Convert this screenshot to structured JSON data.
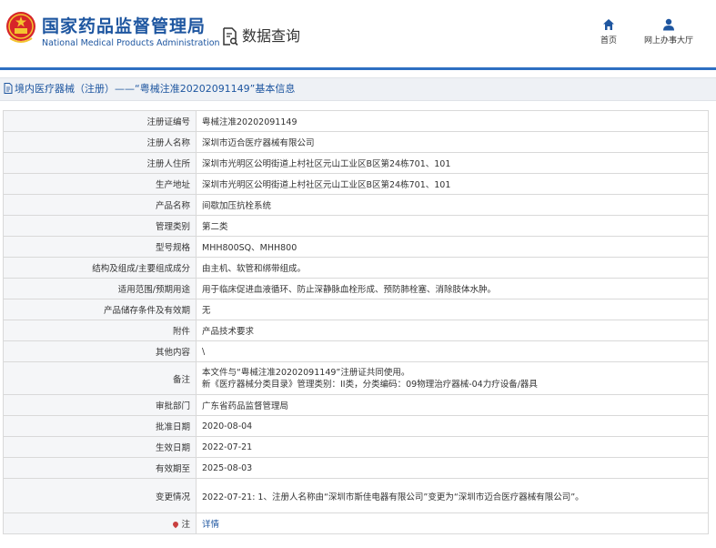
{
  "header": {
    "agency_cn": "国家药品监督管理局",
    "agency_en": "National Medical Products Administration",
    "query_label": "数据查询",
    "nav": [
      {
        "label": "首页",
        "icon": "home-icon"
      },
      {
        "label": "网上办事大厅",
        "icon": "user-icon"
      }
    ]
  },
  "title": "境内医疗器械（注册）——“粤械注准20202091149”基本信息",
  "colors": {
    "brand": "#1e56a0",
    "bar": "#2d6fc2",
    "label_bg": "#f5f6f8"
  },
  "rows": [
    {
      "label": "注册证编号",
      "value": "粤械注准20202091149"
    },
    {
      "label": "注册人名称",
      "value": "深圳市迈合医疗器械有限公司"
    },
    {
      "label": "注册人住所",
      "value": "深圳市光明区公明街道上村社区元山工业区B区第24栋701、101"
    },
    {
      "label": "生产地址",
      "value": "深圳市光明区公明街道上村社区元山工业区B区第24栋701、101"
    },
    {
      "label": "产品名称",
      "value": "间歇加压抗栓系统"
    },
    {
      "label": "管理类别",
      "value": "第二类"
    },
    {
      "label": "型号规格",
      "value": "MHH800SQ、MHH800"
    },
    {
      "label": "结构及组成/主要组成成分",
      "value": "由主机、软管和绑带组成。"
    },
    {
      "label": "适用范围/预期用途",
      "value": "用于临床促进血液循环、防止深静脉血栓形成、预防肺栓塞、消除肢体水肿。"
    },
    {
      "label": "产品储存条件及有效期",
      "value": "无"
    },
    {
      "label": "附件",
      "value": "产品技术要求"
    },
    {
      "label": "其他内容",
      "value": "\\"
    },
    {
      "label": "备注",
      "lines": [
        "本文件与“粤械注准20202091149”注册证共同使用。",
        "新《医疗器械分类目录》管理类别：II类，分类编码：09物理治疗器械-04力疗设备/器具"
      ]
    },
    {
      "label": "审批部门",
      "value": "广东省药品监督管理局"
    },
    {
      "label": "批准日期",
      "value": "2020-08-04"
    },
    {
      "label": "生效日期",
      "value": "2022-07-21"
    },
    {
      "label": "有效期至",
      "value": "2025-08-03"
    },
    {
      "label": "变更情况",
      "value": "2022-07-21: 1、注册人名称由“深圳市斯佳电器有限公司”变更为“深圳市迈合医疗器械有限公司”。"
    },
    {
      "label": "注",
      "value": "详情",
      "link": true
    }
  ]
}
